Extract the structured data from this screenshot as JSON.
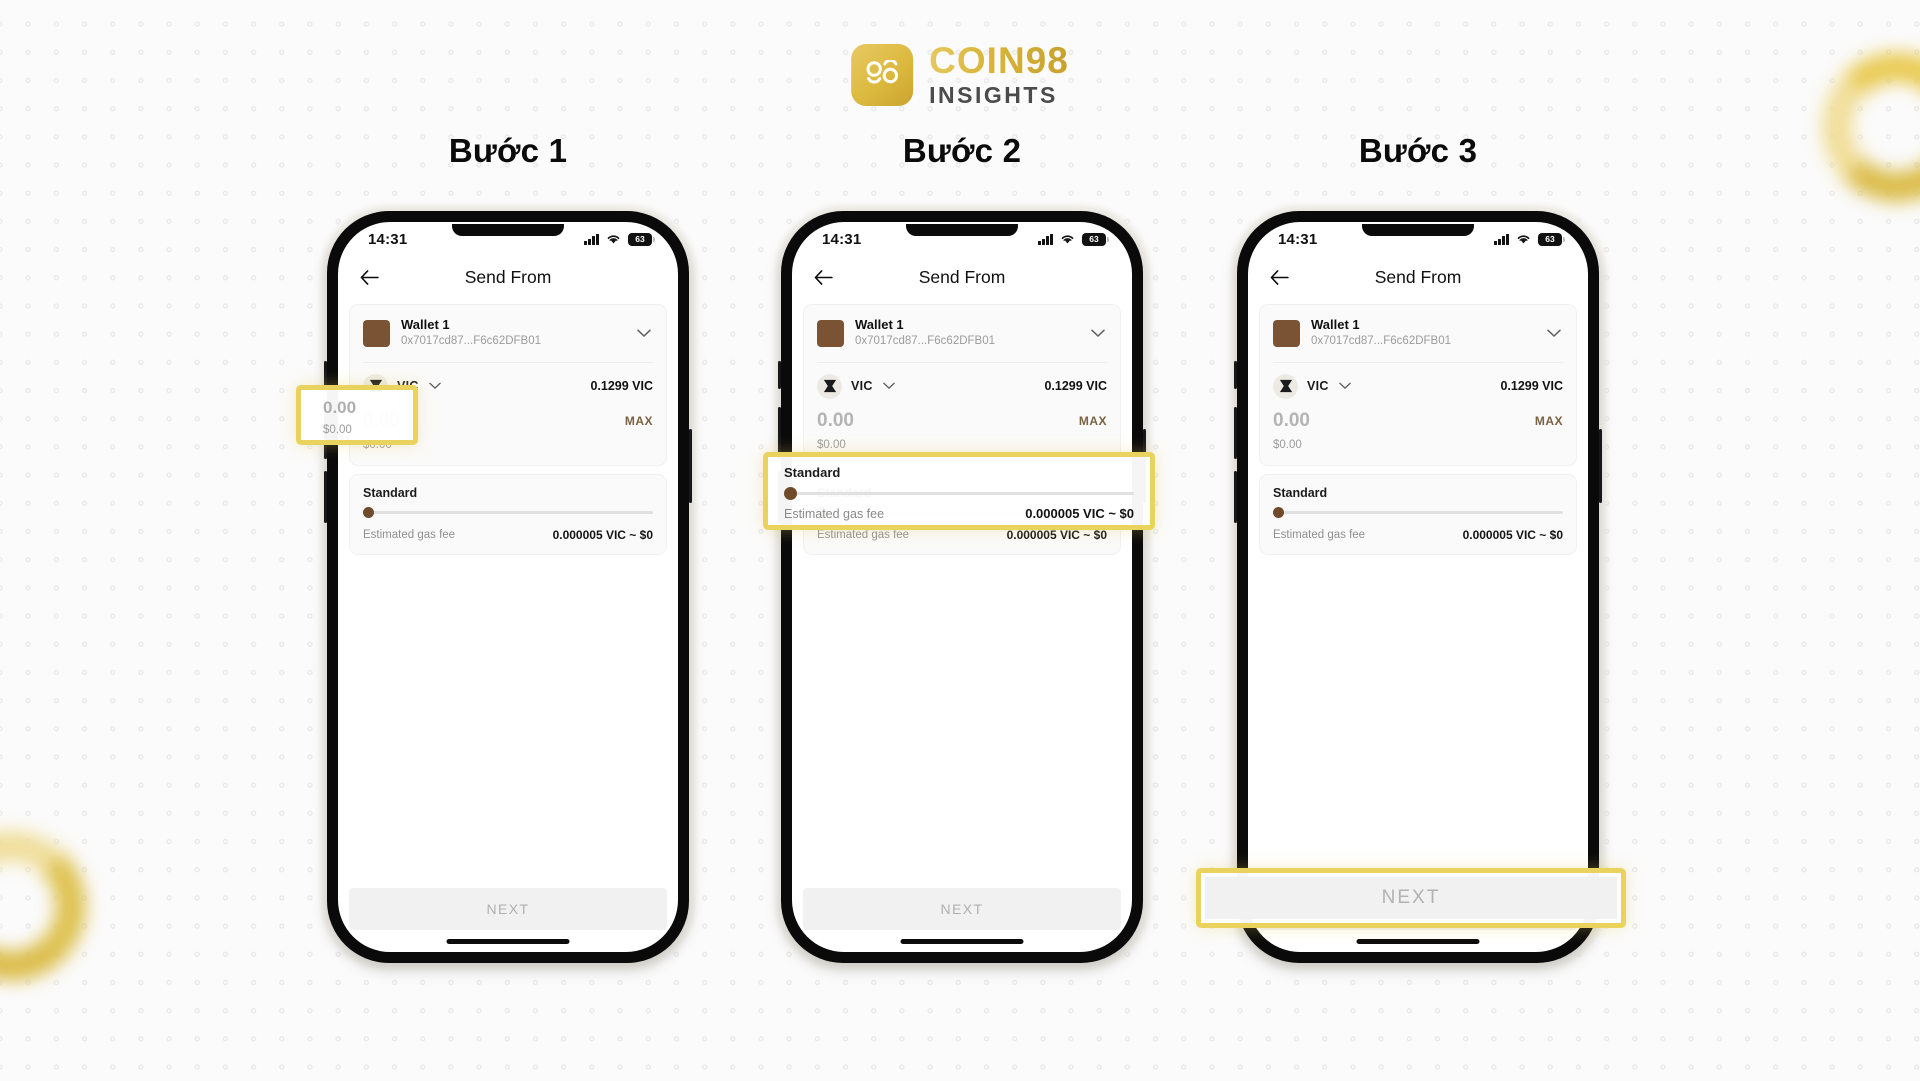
{
  "brand": {
    "name": "COIN98",
    "subtitle": "INSIGHTS",
    "mark_icon": "coin98-logo-icon",
    "accent_color": "#d9b63b"
  },
  "background": {
    "color": "#fbfbfb",
    "dot_color": "#e9e9ea",
    "ring_color": "#dcb93f"
  },
  "steps": [
    {
      "title": "Bước 1"
    },
    {
      "title": "Bước 2"
    },
    {
      "title": "Bước 3"
    }
  ],
  "phone": {
    "status_bar": {
      "time": "14:31",
      "signal_icon": "cellular-signal-icon",
      "wifi_icon": "wifi-icon",
      "battery_icon": "battery-icon",
      "battery_level": "63"
    },
    "nav": {
      "back_icon": "back-arrow-icon",
      "title": "Send From"
    },
    "wallet": {
      "avatar_icon": "wallet-avatar-icon",
      "avatar_color": "#7a5334",
      "name": "Wallet 1",
      "address": "0x7017cd87...F6c62DFB01",
      "chevron_icon": "chevron-down-icon"
    },
    "token": {
      "icon": "vic-token-icon",
      "symbol": "VIC",
      "chevron_icon": "chevron-down-icon",
      "balance": "0.1299 VIC"
    },
    "amount": {
      "value": "0.00",
      "usd": "$0.00",
      "max_label": "MAX"
    },
    "gas": {
      "tier_label": "Standard",
      "slider_icon": "gas-slider-knob",
      "fee_label": "Estimated gas fee",
      "fee_value": "0.000005 VIC ~ $0"
    },
    "next_label": "NEXT"
  },
  "highlights": {
    "step1": {
      "amount": "0.00",
      "usd": "$0.00"
    },
    "step2": {
      "tier_label": "Standard",
      "fee_label": "Estimated gas fee",
      "fee_value": "0.000005 VIC ~ $0"
    },
    "step3": {
      "next_label": "NEXT"
    }
  }
}
